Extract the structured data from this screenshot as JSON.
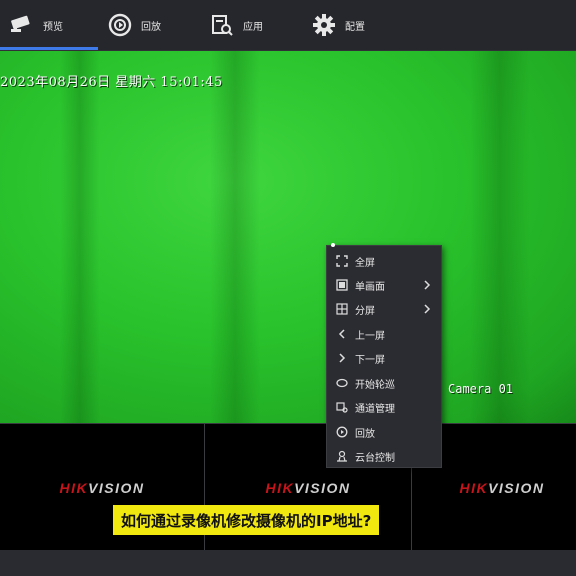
{
  "nav": {
    "tabs": [
      {
        "label": "预览",
        "icon": "camera-icon",
        "active": true
      },
      {
        "label": "回放",
        "icon": "playback-icon",
        "active": false
      },
      {
        "label": "应用",
        "icon": "app-search-icon",
        "active": false
      },
      {
        "label": "配置",
        "icon": "gear-icon",
        "active": false
      }
    ]
  },
  "video": {
    "datetime": "2023年08月26日  星期六  15:01:45",
    "camera_name": "Camera 01",
    "background_color": "#2ec430"
  },
  "context_menu": {
    "items": [
      {
        "label": "全屏",
        "icon": "fullscreen-icon",
        "submenu": false
      },
      {
        "label": "单画面",
        "icon": "single-view-icon",
        "submenu": true
      },
      {
        "label": "分屏",
        "icon": "split-screen-icon",
        "submenu": true
      },
      {
        "label": "上一屏",
        "icon": "chevron-left-icon",
        "submenu": false
      },
      {
        "label": "下一屏",
        "icon": "chevron-right-icon",
        "submenu": false
      },
      {
        "label": "开始轮巡",
        "icon": "patrol-icon",
        "submenu": false
      },
      {
        "label": "通道管理",
        "icon": "channel-manage-icon",
        "submenu": false
      },
      {
        "label": "回放",
        "icon": "playback-icon",
        "submenu": false
      },
      {
        "label": "云台控制",
        "icon": "ptz-icon",
        "submenu": false
      }
    ]
  },
  "tiles": {
    "brand_red": "HIK",
    "brand_white": "VISION",
    "brand_color": "#c7141a"
  },
  "caption": "如何通过录像机修改摄像机的IP地址?",
  "colors": {
    "accent": "#3f7be8",
    "caption_bg": "#f0e80f"
  }
}
